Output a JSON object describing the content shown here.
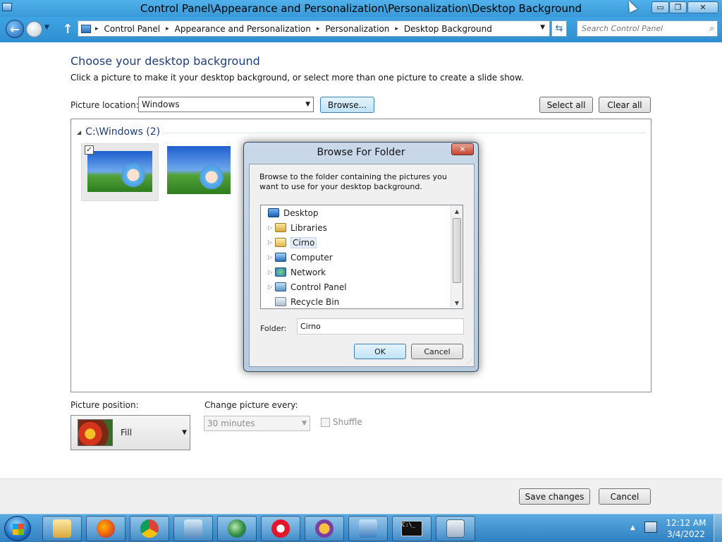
{
  "window": {
    "title": "Control Panel\\Appearance and Personalization\\Personalization\\Desktop Background",
    "minimize_glyph": "▭",
    "restore_glyph": "❐",
    "close_glyph": "✕"
  },
  "nav": {
    "back_glyph": "←",
    "up_glyph": "↑",
    "refresh_glyph": "⇆",
    "breadcrumbs": [
      "Control Panel",
      "Appearance and Personalization",
      "Personalization",
      "Desktop Background"
    ],
    "separator": "▸",
    "search_placeholder": "Search Control Panel",
    "search_icon_glyph": "⌕"
  },
  "page": {
    "heading": "Choose your desktop background",
    "subheading": "Click a picture to make it your desktop background, or select more than one picture to create a slide show.",
    "picture_location_label": "Picture location:",
    "picture_location_value": "Windows",
    "browse_label": "Browse...",
    "select_all_label": "Select all",
    "clear_all_label": "Clear all",
    "group_title": "C:\\Windows (2)",
    "thumbnails": [
      {
        "name": "cirno-wallpaper-1",
        "checked": true
      },
      {
        "name": "cirno-wallpaper-2",
        "checked": false
      }
    ]
  },
  "dialog": {
    "title": "Browse For Folder",
    "close_glyph": "✕",
    "description": "Browse to the folder containing the pictures you want to use for your desktop background.",
    "tree": [
      {
        "label": "Desktop",
        "icon": "desktop-icon",
        "expandable": false,
        "indent": 0
      },
      {
        "label": "Libraries",
        "icon": "libraries-icon",
        "expandable": true,
        "indent": 1
      },
      {
        "label": "Cirno",
        "icon": "user-folder-icon",
        "expandable": true,
        "indent": 1,
        "selected": true
      },
      {
        "label": "Computer",
        "icon": "computer-icon",
        "expandable": true,
        "indent": 1
      },
      {
        "label": "Network",
        "icon": "network-icon",
        "expandable": true,
        "indent": 1
      },
      {
        "label": "Control Panel",
        "icon": "control-panel-icon",
        "expandable": true,
        "indent": 1
      },
      {
        "label": "Recycle Bin",
        "icon": "recycle-bin-icon",
        "expandable": false,
        "indent": 1
      }
    ],
    "folder_label": "Folder:",
    "folder_value": "Cirno",
    "ok_label": "OK",
    "cancel_label": "Cancel"
  },
  "options": {
    "picture_position_label": "Picture position:",
    "picture_position_value": "Fill",
    "change_every_label": "Change picture every:",
    "change_every_value": "30 minutes",
    "shuffle_label": "Shuffle"
  },
  "footer": {
    "save_label": "Save changes",
    "cancel_label": "Cancel"
  },
  "taskbar": {
    "apps": [
      "explorer",
      "firefox",
      "chrome",
      "remote-desktop",
      "globe",
      "opera",
      "shield-app",
      "control-panel",
      "command-prompt",
      "calculator"
    ],
    "cmd_glyph": "C:\\_",
    "tray_up_glyph": "▲",
    "time": "12:12 AM",
    "date": "3/4/2022"
  },
  "colors": {
    "accent_blue": "#3a9ad9",
    "heading_blue": "#1e3f7a"
  }
}
